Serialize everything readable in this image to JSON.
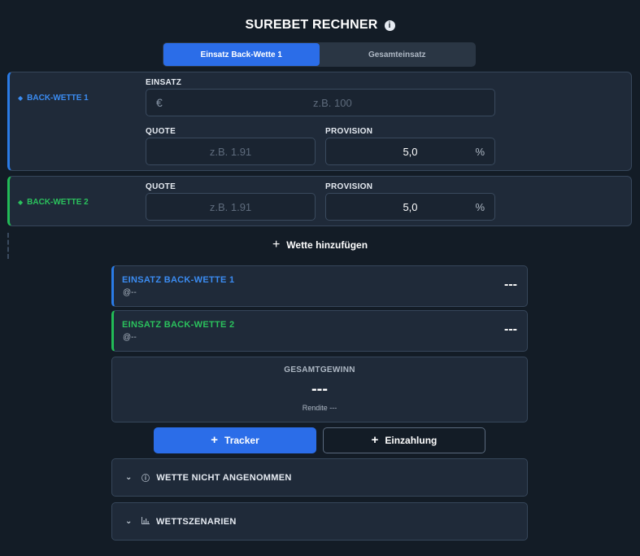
{
  "header": {
    "title": "SUREBET RECHNER",
    "info_icon": "i"
  },
  "mode_tabs": [
    {
      "label": "Einsatz Back-Wette 1",
      "active": true
    },
    {
      "label": "Gesamteinsatz",
      "active": false
    }
  ],
  "bets": [
    {
      "label": "BACK-WETTE 1",
      "color": "#2a7be6",
      "einsatz": {
        "label": "EINSATZ",
        "prefix": "€",
        "placeholder": "z.B. 100",
        "value": ""
      },
      "quote": {
        "label": "QUOTE",
        "placeholder": "z.B. 1.91",
        "value": ""
      },
      "provision": {
        "label": "PROVISION",
        "value": "5,0",
        "suffix": "%"
      }
    },
    {
      "label": "BACK-WETTE 2",
      "color": "#22bb57",
      "quote": {
        "label": "QUOTE",
        "placeholder": "z.B. 1.91",
        "value": ""
      },
      "provision": {
        "label": "PROVISION",
        "value": "5,0",
        "suffix": "%"
      }
    }
  ],
  "add_bet_label": "Wette hinzufügen",
  "results": [
    {
      "title": "EINSATZ BACK-WETTE 1",
      "sub": "@--",
      "value": "---"
    },
    {
      "title": "EINSATZ BACK-WETTE 2",
      "sub": "@--",
      "value": "---"
    }
  ],
  "total": {
    "label": "GESAMTGEWINN",
    "value": "---",
    "sub": "Rendite ---"
  },
  "buttons": {
    "tracker": "Tracker",
    "deposit": "Einzahlung"
  },
  "accordions": [
    {
      "label": "WETTE NICHT ANGENOMMEN",
      "icon": "ⓘ"
    },
    {
      "label": "WETTSZENARIEN",
      "icon": "📊"
    }
  ]
}
